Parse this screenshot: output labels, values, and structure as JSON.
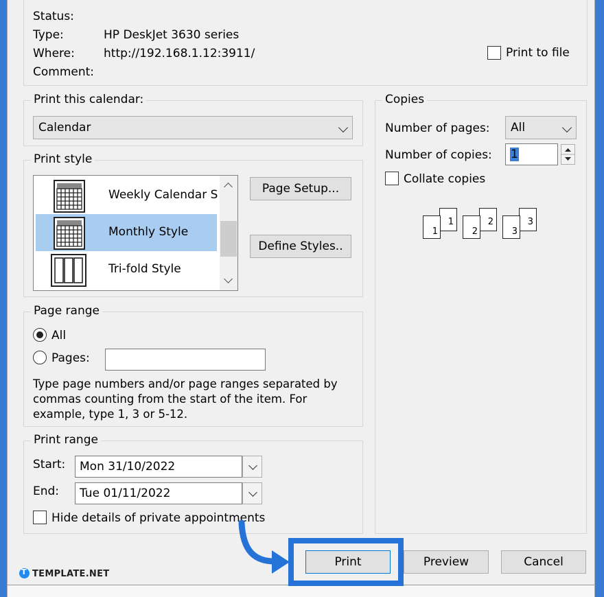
{
  "printer": {
    "status_label": "Status:",
    "type_label": "Type:",
    "type_value": "HP DeskJet 3630 series",
    "where_label": "Where:",
    "where_value": "http://192.168.1.12:3911/",
    "comment_label": "Comment:",
    "print_to_file_label": "Print to file",
    "print_to_file_checked": false
  },
  "print_calendar": {
    "legend": "Print this calendar:",
    "selected": "Calendar"
  },
  "print_style": {
    "legend": "Print style",
    "items": [
      {
        "label": "Weekly Calendar S",
        "selected": false
      },
      {
        "label": "Monthly Style",
        "selected": true
      },
      {
        "label": "Tri-fold Style",
        "selected": false
      }
    ],
    "page_setup_label": "Page Setup...",
    "define_styles_label": "Define Styles.."
  },
  "copies": {
    "legend": "Copies",
    "number_of_pages_label": "Number of pages:",
    "number_of_pages_value": "All",
    "number_of_copies_label": "Number of copies:",
    "number_of_copies_value": "1",
    "collate_label": "Collate copies",
    "collate_checked": false,
    "preview_pages": [
      "1",
      "1",
      "2",
      "2",
      "3",
      "3"
    ]
  },
  "page_range": {
    "legend": "Page range",
    "all_label": "All",
    "pages_label": "Pages:",
    "pages_value": "",
    "help_line1": "Type page numbers and/or page ranges separated by",
    "help_line2": "commas counting from the start of the item.  For",
    "help_line3": "example, type 1, 3 or 5-12."
  },
  "print_range": {
    "legend": "Print range",
    "start_label": "Start:",
    "start_value": "Mon 31/10/2022",
    "end_label": "End:",
    "end_value": "Tue 01/11/2022",
    "hide_details_label": "Hide details of private appointments",
    "hide_details_checked": false
  },
  "buttons": {
    "print": "Print",
    "preview": "Preview",
    "cancel": "Cancel"
  },
  "watermark": {
    "brand": "TEMPLATE.NET"
  },
  "colors": {
    "background": "#3a7bd5",
    "highlight": "#2673d8",
    "selection": "#a8cdf1"
  }
}
